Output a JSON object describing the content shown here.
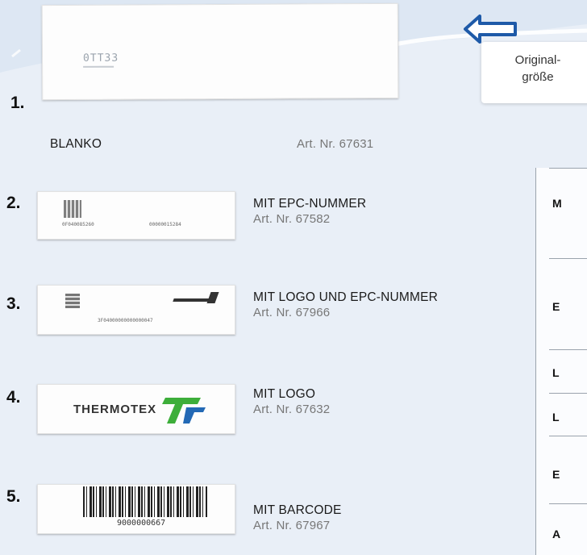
{
  "callout": {
    "line1": "Original-",
    "line2": "größe"
  },
  "items": [
    {
      "number": "1.",
      "label": "BLANKO",
      "art": "Art. Nr. 67631",
      "tag_code": "0TT33"
    },
    {
      "number": "2.",
      "label": "MIT EPC-NUMMER",
      "art": "Art. Nr. 67582",
      "tag_text_a": "0F040085260",
      "tag_text_b": "00000015284"
    },
    {
      "number": "3.",
      "label": "MIT LOGO UND EPC-NUMMER",
      "art": "Art. Nr. 67966",
      "tag_text": "3F04000000000000047"
    },
    {
      "number": "4.",
      "label": "MIT LOGO",
      "art": "Art. Nr. 67632",
      "logo_text": "THERMOTEX"
    },
    {
      "number": "5.",
      "label": "MIT BARCODE",
      "art": "Art. Nr. 67967",
      "barcode_number": "9000000667"
    }
  ],
  "table_rows": [
    "M",
    "E",
    "L",
    "L",
    "E",
    "A"
  ],
  "colors": {
    "accent_blue": "#1e5aa8",
    "logo_green": "#3dae3a",
    "logo_blue": "#2369b5"
  }
}
